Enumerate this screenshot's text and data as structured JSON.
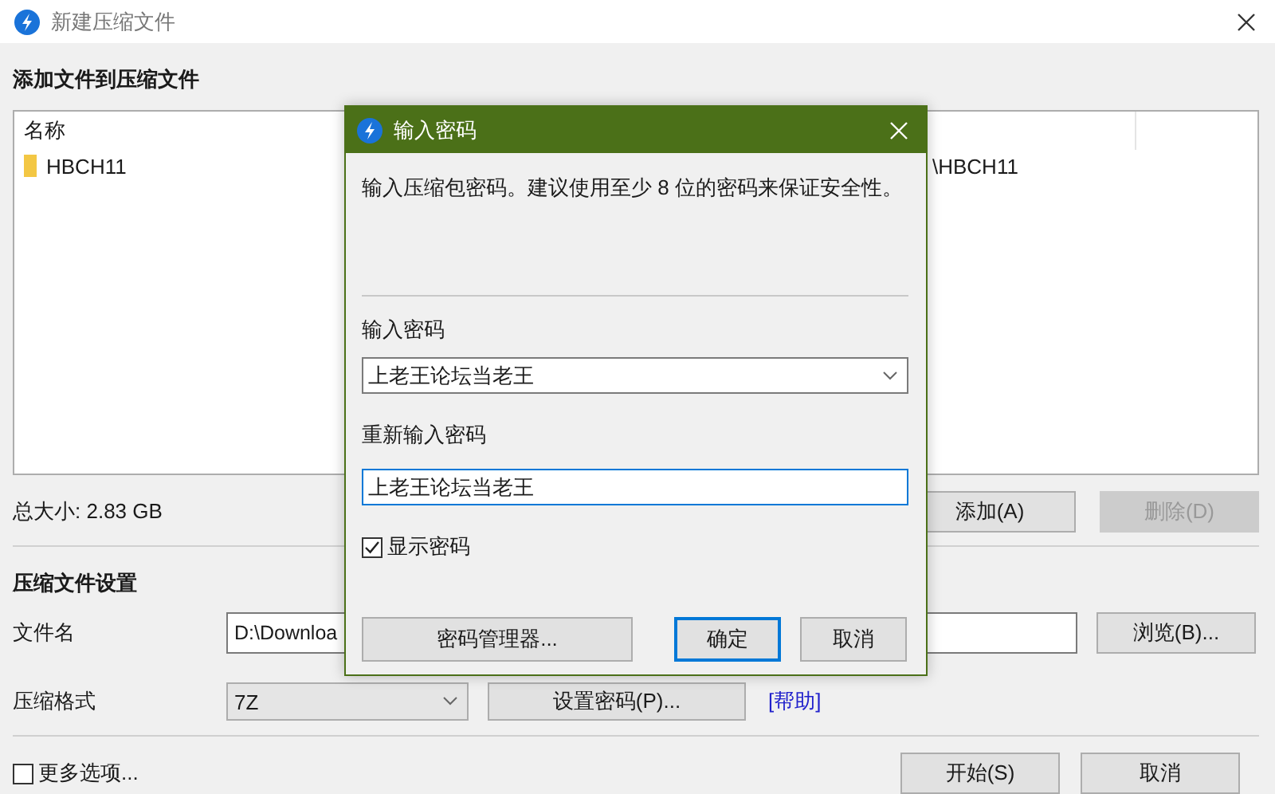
{
  "window": {
    "title": "新建压缩文件"
  },
  "files": {
    "heading": "添加文件到压缩文件",
    "columns": [
      "名称"
    ],
    "rows": [
      {
        "column_1": "HBCH11",
        "column_2": "\\HBCH11"
      }
    ]
  },
  "total_size": "总大小: 2.83 GB",
  "file_buttons": [
    {
      "label": "添加(A)",
      "disabled": false
    },
    {
      "label": "删除(D)",
      "disabled": true
    }
  ],
  "settings": {
    "heading": "压缩文件设置",
    "filename_label": "文件名",
    "filename_value": "D:\\Downloa",
    "browse_button": "浏览(B)...",
    "format_label": "压缩格式",
    "format_value": "7Z",
    "password_button": "设置密码(P)...",
    "help_link": "[帮助]"
  },
  "more_options": {
    "label": "更多选项...",
    "checked": false
  },
  "footer_buttons": [
    {
      "label": "开始(S)"
    },
    {
      "label": "取消"
    }
  ],
  "dialog": {
    "title": "输入密码",
    "description": "输入压缩包密码。建议使用至少 8 位的密码来保证安全性。",
    "password_label": "输入密码",
    "password_value": "上老王论坛当老王",
    "confirm_label": "重新输入密码",
    "confirm_value": "上老王论坛当老王",
    "show_password": {
      "label": "显示密码",
      "checked": true
    },
    "buttons": [
      {
        "label": "密码管理器...",
        "default": false
      },
      {
        "label": "确定",
        "default": true
      },
      {
        "label": "取消",
        "default": false
      }
    ]
  }
}
